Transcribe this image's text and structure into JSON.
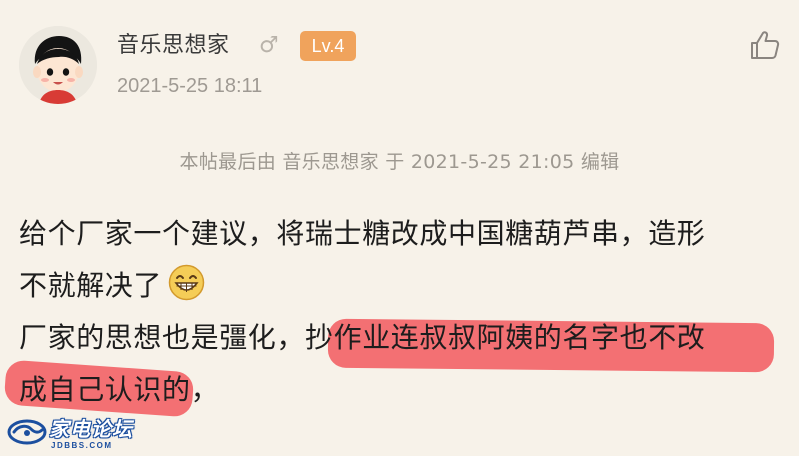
{
  "post": {
    "username": "音乐思想家",
    "level": "Lv.4",
    "timestamp": "2021-5-25 18:11",
    "edit_note": "本帖最后由 音乐思想家 于 2021-5-25 21:05 编辑",
    "content_lines": [
      "给个厂家一个建议，将瑞士糖改成中国糖葫芦串，造形",
      "不就解决了",
      "厂家的思想也是彊化，抄作业连叔叔阿姨的名字也不改",
      "成自己认识的，"
    ]
  },
  "icons": {
    "avatar": "cartoon-boy-avatar",
    "gender": "male-symbol-icon",
    "like": "thumbs-up-icon",
    "emoji": "grinning-face-emoji"
  },
  "gender_symbol": "♂",
  "watermark": {
    "title": "家电论坛",
    "url": "JDBBS.COM"
  },
  "colors": {
    "background": "#f7f2e9",
    "level_badge": "#f0a35c",
    "highlight": "#f25d62",
    "meta_text": "#9f9a93",
    "watermark_blue": "#1c4f9f"
  }
}
